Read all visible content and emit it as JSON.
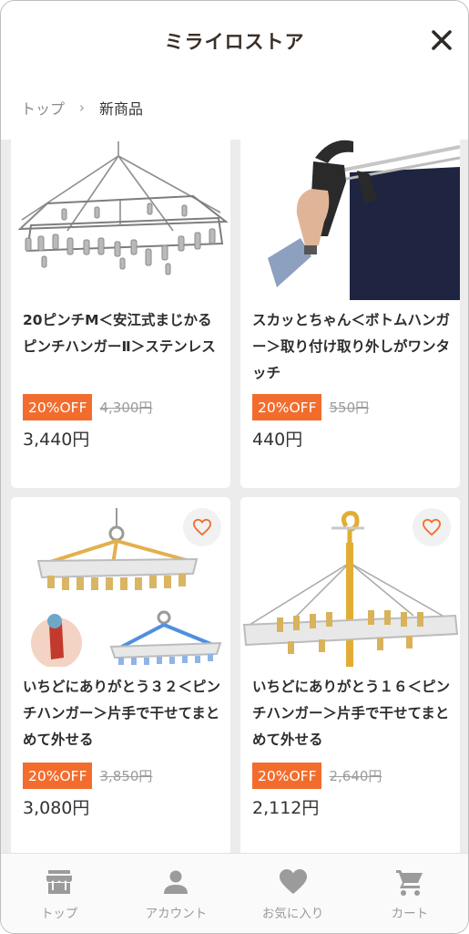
{
  "header": {
    "title": "ミライロストア"
  },
  "breadcrumb": {
    "top": "トップ",
    "separator": "›",
    "current": "新商品"
  },
  "products": [
    {
      "name": "20ピンチM＜安江式まじかるピンチハンガーⅡ＞ステンレス",
      "badge": "20%OFF",
      "original_price": "4,300円",
      "price": "3,440円",
      "image": "stainless-pinch-hanger"
    },
    {
      "name": "スカッとちゃん＜ボトムハンガー＞取り付け取り外しがワンタッチ",
      "badge": "20%OFF",
      "original_price": "550円",
      "price": "440円",
      "image": "bottom-hanger-in-hand"
    },
    {
      "name": "いちどにありがとう３２＜ピンチハンガー＞片手で干せてまとめて外せる",
      "badge": "20%OFF",
      "original_price": "3,850円",
      "price": "3,080円",
      "image": "pinch-hanger-32"
    },
    {
      "name": "いちどにありがとう１６＜ピンチハンガー＞片手で干せてまとめて外せる",
      "badge": "20%OFF",
      "original_price": "2,640円",
      "price": "2,112円",
      "image": "pinch-hanger-16"
    }
  ],
  "tabs": [
    {
      "label": "トップ",
      "icon": "store-icon"
    },
    {
      "label": "アカウント",
      "icon": "person-icon"
    },
    {
      "label": "お気に入り",
      "icon": "heart-icon"
    },
    {
      "label": "カート",
      "icon": "cart-icon"
    }
  ],
  "colors": {
    "accent": "#f26d2d",
    "title": "#3a2f26",
    "tab_icon": "#9b9b9b"
  }
}
